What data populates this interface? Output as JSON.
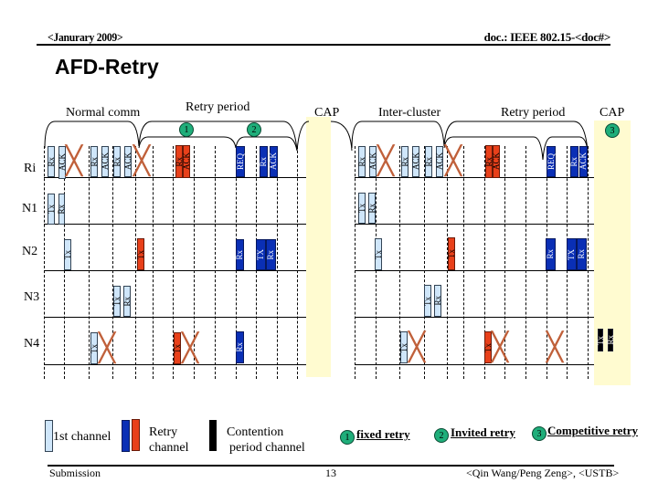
{
  "header": {
    "left": "<Janurary 2009>",
    "right": "doc.: IEEE 802.15-<doc#>"
  },
  "title": "AFD-Retry",
  "periods": {
    "normal_comm": "Normal comm",
    "retry_period_1": "Retry period",
    "cap_1": "CAP",
    "inter_cluster": "Inter-cluster",
    "retry_period_2": "Retry period",
    "cap_2": "CAP"
  },
  "badges": [
    "1",
    "2",
    "3"
  ],
  "rows": [
    "Ri",
    "N1",
    "N2",
    "N3",
    "N4"
  ],
  "blocks": {
    "ri": [
      "Rx",
      "ACK",
      "Rx",
      "ACK",
      "Rx",
      "ACK",
      "Rx",
      "ACK",
      "REQ",
      "Rx",
      "ACK",
      "Rx",
      "ACK",
      "Rx",
      "ACK",
      "Rx",
      "ACK",
      "Rx",
      "ACK",
      "REQ",
      "Rx",
      "ACK"
    ],
    "n1": [
      "Tx",
      "Rx",
      "Tx",
      "Rx"
    ],
    "n2": [
      "Tx",
      "Tx",
      "Rx",
      "TX",
      "Rx",
      "Tx",
      "Tx",
      "Rx",
      "TX",
      "Rx"
    ],
    "n3": [
      "Tx",
      "Rx",
      "Tx",
      "Rx"
    ],
    "n4": [
      "Tx",
      "Tx",
      "Rx",
      "Tx",
      "Tx",
      "Tx",
      "Rx"
    ]
  },
  "legend": {
    "first_channel": "1st channel",
    "retry_channel_l1": "Retry",
    "retry_channel_l2": "channel",
    "contention_l1": "Contention",
    "contention_l2": "period channel",
    "fixed_retry": "fixed retry",
    "invited_retry": "Invited retry",
    "competitive_retry": "Competitive retry"
  },
  "footer": {
    "left": "Submission",
    "page": "13",
    "right": "<Qin Wang/Peng Zeng>, <USTB>"
  },
  "colors": {
    "first_channel": "#cfe6fa",
    "retry_blue": "#0a2fb5",
    "retry_red": "#e8401a",
    "contention": "#000000",
    "cap_band": "#fffbd0",
    "badge": "#1fae7a",
    "collision_x": "#c0603a"
  }
}
